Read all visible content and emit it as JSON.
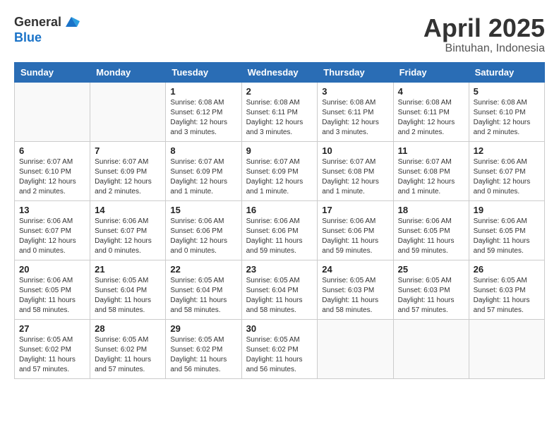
{
  "header": {
    "logo_general": "General",
    "logo_blue": "Blue",
    "month": "April 2025",
    "location": "Bintuhan, Indonesia"
  },
  "weekdays": [
    "Sunday",
    "Monday",
    "Tuesday",
    "Wednesday",
    "Thursday",
    "Friday",
    "Saturday"
  ],
  "weeks": [
    [
      {
        "day": "",
        "info": ""
      },
      {
        "day": "",
        "info": ""
      },
      {
        "day": "1",
        "info": "Sunrise: 6:08 AM\nSunset: 6:12 PM\nDaylight: 12 hours and 3 minutes."
      },
      {
        "day": "2",
        "info": "Sunrise: 6:08 AM\nSunset: 6:11 PM\nDaylight: 12 hours and 3 minutes."
      },
      {
        "day": "3",
        "info": "Sunrise: 6:08 AM\nSunset: 6:11 PM\nDaylight: 12 hours and 3 minutes."
      },
      {
        "day": "4",
        "info": "Sunrise: 6:08 AM\nSunset: 6:11 PM\nDaylight: 12 hours and 2 minutes."
      },
      {
        "day": "5",
        "info": "Sunrise: 6:08 AM\nSunset: 6:10 PM\nDaylight: 12 hours and 2 minutes."
      }
    ],
    [
      {
        "day": "6",
        "info": "Sunrise: 6:07 AM\nSunset: 6:10 PM\nDaylight: 12 hours and 2 minutes."
      },
      {
        "day": "7",
        "info": "Sunrise: 6:07 AM\nSunset: 6:09 PM\nDaylight: 12 hours and 2 minutes."
      },
      {
        "day": "8",
        "info": "Sunrise: 6:07 AM\nSunset: 6:09 PM\nDaylight: 12 hours and 1 minute."
      },
      {
        "day": "9",
        "info": "Sunrise: 6:07 AM\nSunset: 6:09 PM\nDaylight: 12 hours and 1 minute."
      },
      {
        "day": "10",
        "info": "Sunrise: 6:07 AM\nSunset: 6:08 PM\nDaylight: 12 hours and 1 minute."
      },
      {
        "day": "11",
        "info": "Sunrise: 6:07 AM\nSunset: 6:08 PM\nDaylight: 12 hours and 1 minute."
      },
      {
        "day": "12",
        "info": "Sunrise: 6:06 AM\nSunset: 6:07 PM\nDaylight: 12 hours and 0 minutes."
      }
    ],
    [
      {
        "day": "13",
        "info": "Sunrise: 6:06 AM\nSunset: 6:07 PM\nDaylight: 12 hours and 0 minutes."
      },
      {
        "day": "14",
        "info": "Sunrise: 6:06 AM\nSunset: 6:07 PM\nDaylight: 12 hours and 0 minutes."
      },
      {
        "day": "15",
        "info": "Sunrise: 6:06 AM\nSunset: 6:06 PM\nDaylight: 12 hours and 0 minutes."
      },
      {
        "day": "16",
        "info": "Sunrise: 6:06 AM\nSunset: 6:06 PM\nDaylight: 11 hours and 59 minutes."
      },
      {
        "day": "17",
        "info": "Sunrise: 6:06 AM\nSunset: 6:06 PM\nDaylight: 11 hours and 59 minutes."
      },
      {
        "day": "18",
        "info": "Sunrise: 6:06 AM\nSunset: 6:05 PM\nDaylight: 11 hours and 59 minutes."
      },
      {
        "day": "19",
        "info": "Sunrise: 6:06 AM\nSunset: 6:05 PM\nDaylight: 11 hours and 59 minutes."
      }
    ],
    [
      {
        "day": "20",
        "info": "Sunrise: 6:06 AM\nSunset: 6:05 PM\nDaylight: 11 hours and 58 minutes."
      },
      {
        "day": "21",
        "info": "Sunrise: 6:05 AM\nSunset: 6:04 PM\nDaylight: 11 hours and 58 minutes."
      },
      {
        "day": "22",
        "info": "Sunrise: 6:05 AM\nSunset: 6:04 PM\nDaylight: 11 hours and 58 minutes."
      },
      {
        "day": "23",
        "info": "Sunrise: 6:05 AM\nSunset: 6:04 PM\nDaylight: 11 hours and 58 minutes."
      },
      {
        "day": "24",
        "info": "Sunrise: 6:05 AM\nSunset: 6:03 PM\nDaylight: 11 hours and 58 minutes."
      },
      {
        "day": "25",
        "info": "Sunrise: 6:05 AM\nSunset: 6:03 PM\nDaylight: 11 hours and 57 minutes."
      },
      {
        "day": "26",
        "info": "Sunrise: 6:05 AM\nSunset: 6:03 PM\nDaylight: 11 hours and 57 minutes."
      }
    ],
    [
      {
        "day": "27",
        "info": "Sunrise: 6:05 AM\nSunset: 6:02 PM\nDaylight: 11 hours and 57 minutes."
      },
      {
        "day": "28",
        "info": "Sunrise: 6:05 AM\nSunset: 6:02 PM\nDaylight: 11 hours and 57 minutes."
      },
      {
        "day": "29",
        "info": "Sunrise: 6:05 AM\nSunset: 6:02 PM\nDaylight: 11 hours and 56 minutes."
      },
      {
        "day": "30",
        "info": "Sunrise: 6:05 AM\nSunset: 6:02 PM\nDaylight: 11 hours and 56 minutes."
      },
      {
        "day": "",
        "info": ""
      },
      {
        "day": "",
        "info": ""
      },
      {
        "day": "",
        "info": ""
      }
    ]
  ]
}
